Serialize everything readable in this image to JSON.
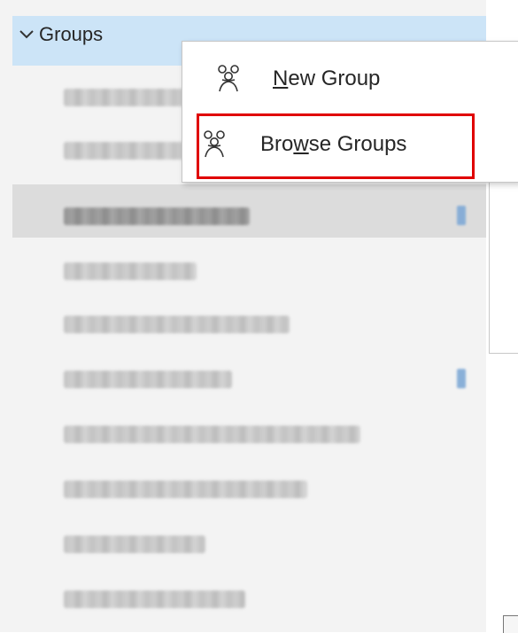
{
  "folder_pane": {
    "groups_header": {
      "label": "Groups",
      "icon": "chevron-down-icon"
    },
    "group_items": [
      {
        "selected": false,
        "has_count": false
      },
      {
        "selected": false,
        "has_count": false
      },
      {
        "selected": true,
        "has_count": true
      },
      {
        "selected": false,
        "has_count": false
      },
      {
        "selected": false,
        "has_count": false
      },
      {
        "selected": false,
        "has_count": true
      },
      {
        "selected": false,
        "has_count": false
      },
      {
        "selected": false,
        "has_count": false
      },
      {
        "selected": false,
        "has_count": false
      },
      {
        "selected": false,
        "has_count": false
      }
    ]
  },
  "context_menu": {
    "items": [
      {
        "label_prefix": "",
        "mnemonic": "N",
        "label_suffix": "ew Group",
        "icon": "group-people-icon"
      },
      {
        "label_prefix": "Bro",
        "mnemonic": "w",
        "label_suffix": "se Groups",
        "icon": "group-people-icon"
      }
    ]
  },
  "colors": {
    "header_selected": "#cce4f7",
    "item_selected": "#dcdcdc",
    "pane_background": "#f3f3f3",
    "highlight_border": "#e00000"
  }
}
